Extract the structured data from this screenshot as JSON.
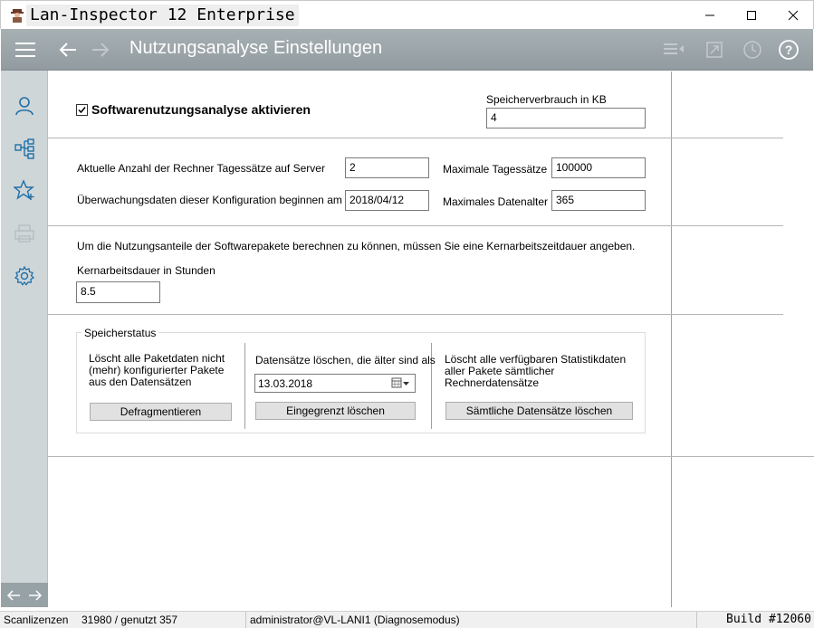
{
  "window": {
    "title": "Lan-Inspector 12 Enterprise",
    "icon": "spy-agent-icon"
  },
  "toolbar": {
    "page_title": "Nutzungsanalyse Einstellungen",
    "colors": {
      "background": "#9aa4a8",
      "text": "#ffffff"
    }
  },
  "sidebar": {
    "items": [
      {
        "icon": "user-icon"
      },
      {
        "icon": "network-tree-icon"
      },
      {
        "icon": "star-add-icon"
      },
      {
        "icon": "printer-icon"
      },
      {
        "icon": "gear-icon"
      }
    ]
  },
  "settings": {
    "enable_label": "Softwarenutzungsanalyse aktivieren",
    "enable_checked": true,
    "storage_kb_label": "Speicherverbrauch in KB",
    "storage_kb_value": "4",
    "current_count_label": "Aktuelle Anzahl der Rechner Tagessätze auf Server",
    "current_count_value": "2",
    "max_daily_label": "Maximale Tagessätze",
    "max_daily_value": "100000",
    "start_date_label": "Überwachungsdaten dieser Konfiguration beginnen am",
    "start_date_value": "2018/04/12",
    "max_age_label": "Maximales Datenalter",
    "max_age_value": "365",
    "info_text": "Um die Nutzungsanteile der Softwarepakete berechnen zu können, müssen Sie eine Kernarbeitszeitdauer angeben.",
    "core_hours_label": "Kernarbeitsdauer in Stunden",
    "core_hours_value": "8.5"
  },
  "storage_status": {
    "title": "Speicherstatus",
    "col1_text": "Löscht alle Paketdaten nicht (mehr) konfigurierter Pakete aus den Datensätzen",
    "col1_button": "Defragmentieren",
    "col2_text": "Datensätze löschen, die älter sind als",
    "col2_date": "13.03.2018",
    "col2_button": "Eingegrenzt löschen",
    "col3_text": "Löscht alle verfügbaren Statistikdaten aller Pakete sämtlicher Rechnerdatensätze",
    "col3_button": "Sämtliche Datensätze löschen"
  },
  "statusbar": {
    "licenses_label": "Scanlizenzen",
    "licenses_value": "31980 / genutzt 357",
    "user": "administrator@VL-LANI1 (Diagnosemodus)",
    "build": "Build #12060"
  }
}
